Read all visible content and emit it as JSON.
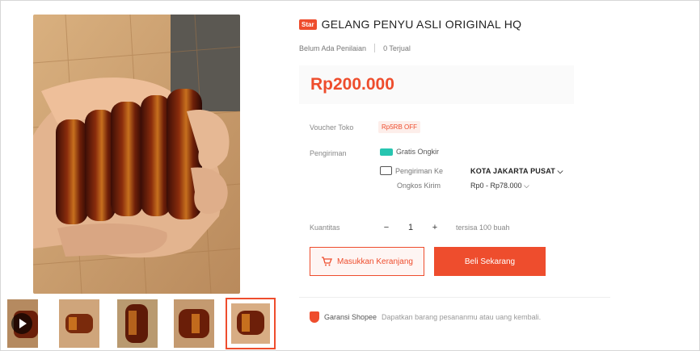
{
  "product": {
    "badge": "Star",
    "title": "GELANG PENYU ASLI ORIGINAL HQ",
    "rating_text": "Belum Ada Penilaian",
    "sold_text": "0 Terjual",
    "price": "Rp200.000"
  },
  "details": {
    "voucher_label": "Voucher Toko",
    "voucher_value": "Rp5RB OFF",
    "shipping_label": "Pengiriman",
    "free_shipping": "Gratis Ongkir",
    "ship_to_label": "Pengiriman Ke",
    "ship_to_city": "KOTA JAKARTA PUSAT ⌵",
    "shipping_cost_label": "Ongkos Kirim",
    "shipping_cost": "Rp0 - Rp78.000 ⌵"
  },
  "quantity": {
    "label": "Kuantitas",
    "minus": "−",
    "value": "1",
    "plus": "+",
    "stock": "tersisa 100 buah"
  },
  "actions": {
    "add_to_cart": "Masukkan Keranjang",
    "buy_now": "Beli Sekarang"
  },
  "guarantee": {
    "title": "Garansi Shopee",
    "description": "Dapatkan barang pesananmu atau uang kembali."
  },
  "colors": {
    "accent": "#ee4d2d",
    "free_shipping": "#27c5b0"
  }
}
